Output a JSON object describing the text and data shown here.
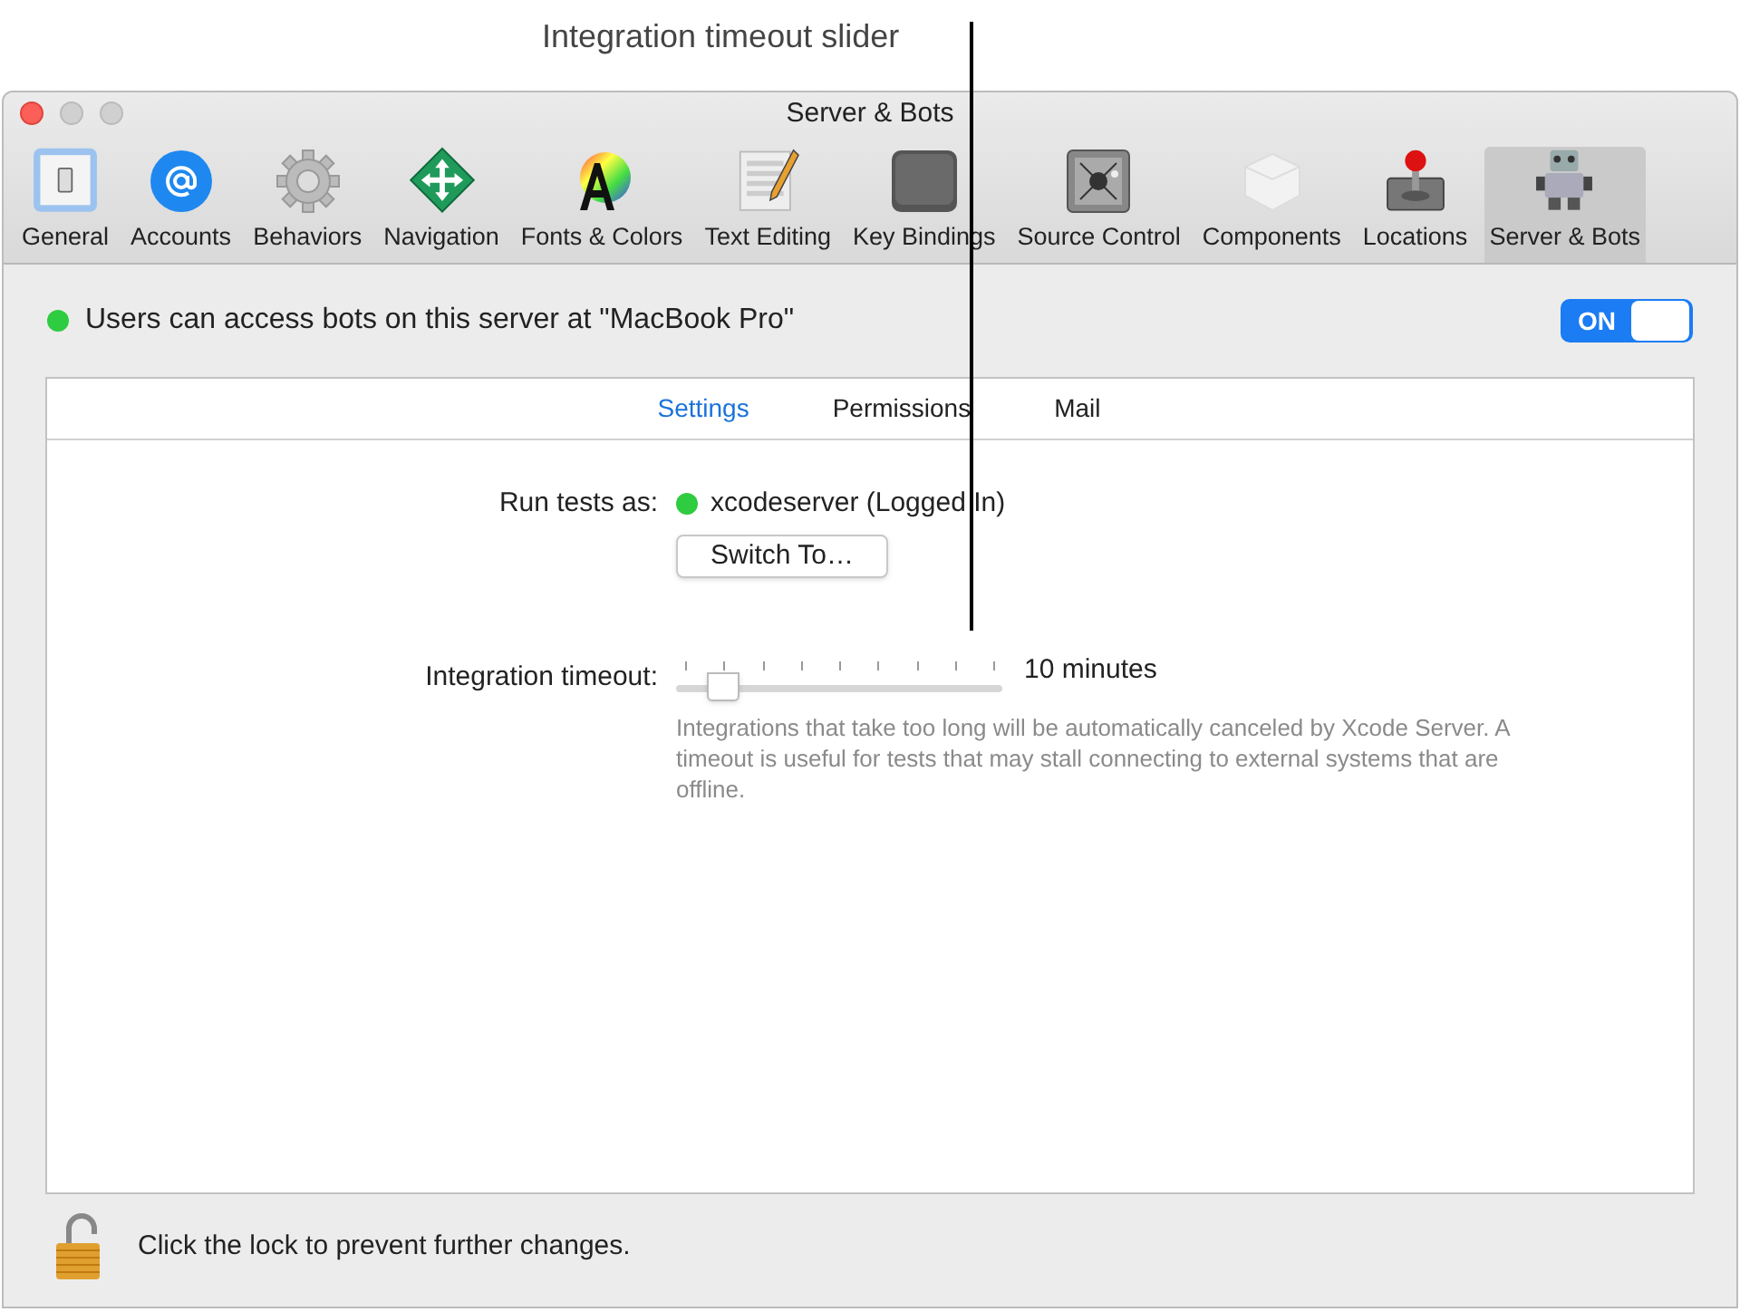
{
  "callout": {
    "text": "Integration timeout slider"
  },
  "window": {
    "title": "Server & Bots"
  },
  "toolbar": [
    {
      "label": "General",
      "kind": "switch",
      "selected": false
    },
    {
      "label": "Accounts",
      "kind": "at",
      "selected": false
    },
    {
      "label": "Behaviors",
      "kind": "gear",
      "selected": false
    },
    {
      "label": "Navigation",
      "kind": "arrows",
      "selected": false
    },
    {
      "label": "Fonts & Colors",
      "kind": "palette",
      "selected": false
    },
    {
      "label": "Text Editing",
      "kind": "pencil",
      "selected": false
    },
    {
      "label": "Key Bindings",
      "kind": "key",
      "selected": false
    },
    {
      "label": "Source Control",
      "kind": "safe",
      "selected": false
    },
    {
      "label": "Components",
      "kind": "brick",
      "selected": false
    },
    {
      "label": "Locations",
      "kind": "joystick",
      "selected": false
    },
    {
      "label": "Server & Bots",
      "kind": "robot",
      "selected": true
    }
  ],
  "service": {
    "status": "Users can access bots on this server at \"MacBook Pro\"",
    "color": "#2ecc40",
    "switch_label": "ON",
    "on": true
  },
  "tabs": [
    {
      "label": "Settings",
      "selected": true
    },
    {
      "label": "Permissions",
      "selected": false
    },
    {
      "label": "Mail",
      "selected": false
    }
  ],
  "run_tests": {
    "label": "Run tests as:",
    "user": "xcodeserver (Logged In)",
    "color": "#2ecc40",
    "button": "Switch To…"
  },
  "timeout": {
    "label": "Integration timeout:",
    "level": 0.125,
    "reading": "10 minutes",
    "help": "Integrations that take too long will be automatically canceled by Xcode Server.  A timeout is useful for tests that may stall connecting to external systems that are offline."
  },
  "footer": {
    "text": "Click the lock to prevent further changes."
  }
}
